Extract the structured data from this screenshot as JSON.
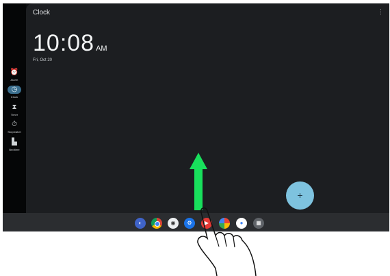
{
  "app": {
    "title": "Clock",
    "menu_label": "⋮"
  },
  "clock": {
    "time": "10:08",
    "ampm": "AM",
    "date": "Fri, Oct 20"
  },
  "navigation": [
    {
      "label": "Alarm",
      "icon": "alarm-icon",
      "glyph": "⏰"
    },
    {
      "label": "Clock",
      "icon": "clock-icon",
      "glyph": "◷",
      "active": true
    },
    {
      "label": "Timer",
      "icon": "hourglass-icon",
      "glyph": "⧗"
    },
    {
      "label": "Stopwatch",
      "icon": "stopwatch-icon",
      "glyph": "⏱"
    },
    {
      "label": "Bedtime",
      "icon": "bed-icon",
      "glyph": "▙"
    }
  ],
  "fab": {
    "label": "+"
  },
  "dock": {
    "apps": [
      {
        "icon": "app-icon-1",
        "color": "#3f63c8"
      },
      {
        "icon": "chrome-icon",
        "color": "#db4437"
      },
      {
        "icon": "camera-icon",
        "color": "#5f6368"
      },
      {
        "icon": "settings-icon",
        "color": "#1a73e8"
      },
      {
        "icon": "youtube-music-icon",
        "color": "#e53935"
      },
      {
        "icon": "photos-icon",
        "color": "#fbbc04"
      },
      {
        "icon": "assistant-icon",
        "color": "#4285f4"
      },
      {
        "icon": "apps-icon",
        "color": "#34a853"
      }
    ]
  },
  "gesture": {
    "arrow_color": "#18e05c",
    "hand_icon": "swipe-up-hand-icon"
  }
}
